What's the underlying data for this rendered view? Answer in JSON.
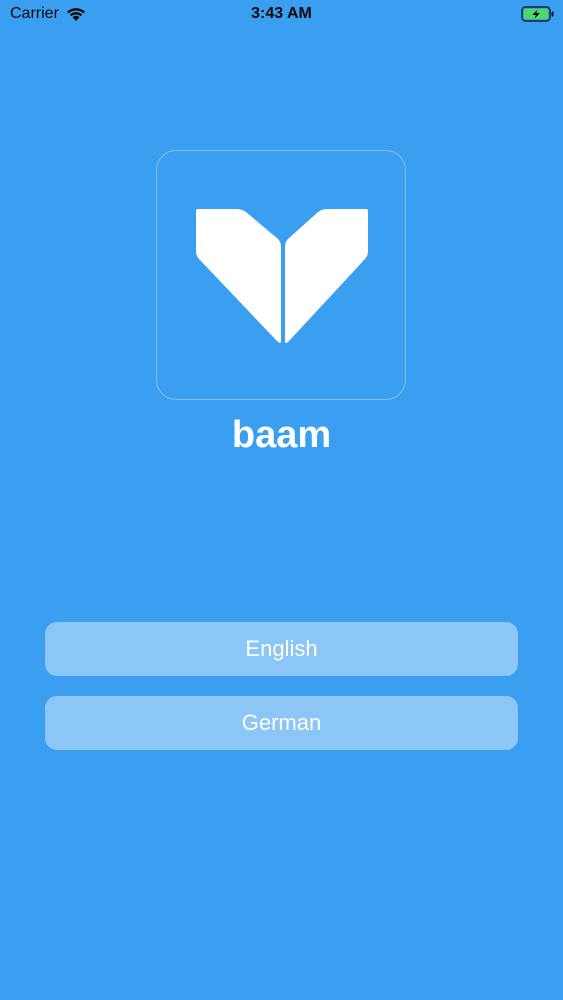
{
  "status_bar": {
    "carrier": "Carrier",
    "time": "3:43 AM",
    "wifi_icon": "wifi-icon",
    "battery_icon": "battery-charging-icon"
  },
  "app": {
    "name": "baam",
    "logo_icon": "heart-logo-icon"
  },
  "language_buttons": [
    {
      "label": "English"
    },
    {
      "label": "German"
    }
  ],
  "colors": {
    "background": "#3a9ef1",
    "button_fill": "rgba(255,255,255,0.42)",
    "text": "#ffffff",
    "battery_green": "#4cd964"
  }
}
